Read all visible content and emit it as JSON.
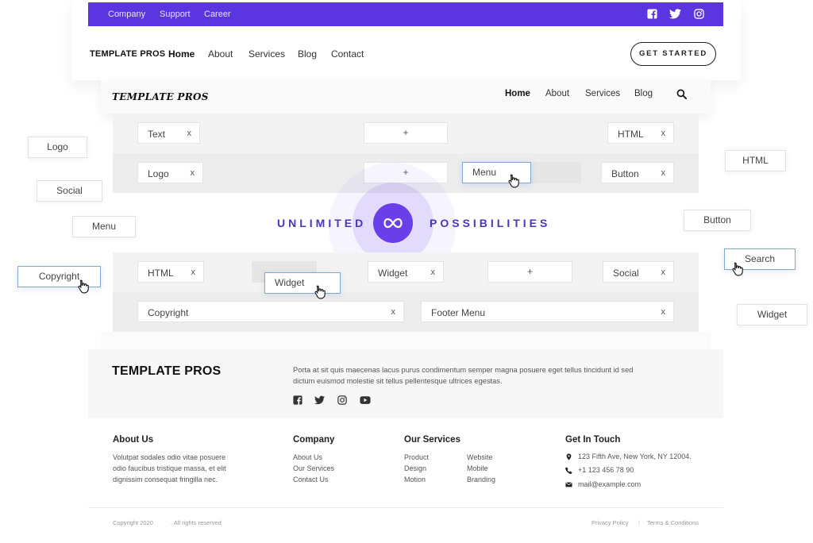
{
  "header1": {
    "topbar_links": [
      "Company",
      "Support",
      "Career"
    ],
    "social_icons": [
      "facebook-icon",
      "twitter-icon",
      "instagram-icon"
    ],
    "logo": "TEMPLATE PROS",
    "nav": [
      "Home",
      "About",
      "Services",
      "Blog",
      "Contact"
    ],
    "cta": "GET STARTED",
    "accent": "#5b35e0"
  },
  "header2": {
    "logo": "TEMPLATE PROS",
    "nav": [
      "Home",
      "About",
      "Services",
      "Blog"
    ],
    "search_icon": "search-icon"
  },
  "builder": {
    "row1": {
      "left": "Text",
      "center": "+",
      "right": "HTML"
    },
    "row2": {
      "left": "Logo",
      "center": "+",
      "dragging": "Menu",
      "right": "Button"
    },
    "row3": {
      "left": "HTML",
      "dragging": "Widget",
      "center": "Widget",
      "plus": "+",
      "right": "Social"
    },
    "row4": {
      "left": "Copyright",
      "right": "Footer Menu"
    },
    "remove": "x"
  },
  "floating": {
    "left": [
      "Logo",
      "Social",
      "Menu",
      "Copyright"
    ],
    "right": [
      "HTML",
      "Button",
      "Search",
      "Widget"
    ]
  },
  "banner": {
    "left_text": "UNLIMITED",
    "right_text": "POSSIBILITIES",
    "icon": "infinity-icon"
  },
  "footer": {
    "brand": "TEMPLATE PROS",
    "description": "Porta at sit quis maecenas lacus purus condimentum semper magna posuere eget tellus tincidunt id sed dictum euismod molestie sit tellus pellentesque ultrices egestas.",
    "social_icons": [
      "facebook-icon",
      "twitter-icon",
      "instagram-icon",
      "youtube-icon"
    ],
    "about": {
      "title": "About Us",
      "text": [
        "Volutpat sodales odio vitae posuere",
        "odio faucibus tristique massa, et elit",
        "dignissim consequat fringilla nec."
      ]
    },
    "company": {
      "title": "Company",
      "links": [
        "About Us",
        "Our Services",
        "Contact Us"
      ]
    },
    "services": {
      "title": "Our Services",
      "col1": [
        "Product",
        "Design",
        "Motion"
      ],
      "col2": [
        "Website",
        "Mobile",
        "Branding"
      ]
    },
    "contact": {
      "title": "Get In Touch",
      "address": "123 Fifth Ave, New York, NY 12004.",
      "phone": "+1 123 456 78 90",
      "email": "mail@example.com"
    },
    "copyright": "Copyright 2020",
    "rights": ". All rights reserved",
    "privacy": "Privacy Policy",
    "separator": "|",
    "terms": "Terms & Conditions"
  }
}
